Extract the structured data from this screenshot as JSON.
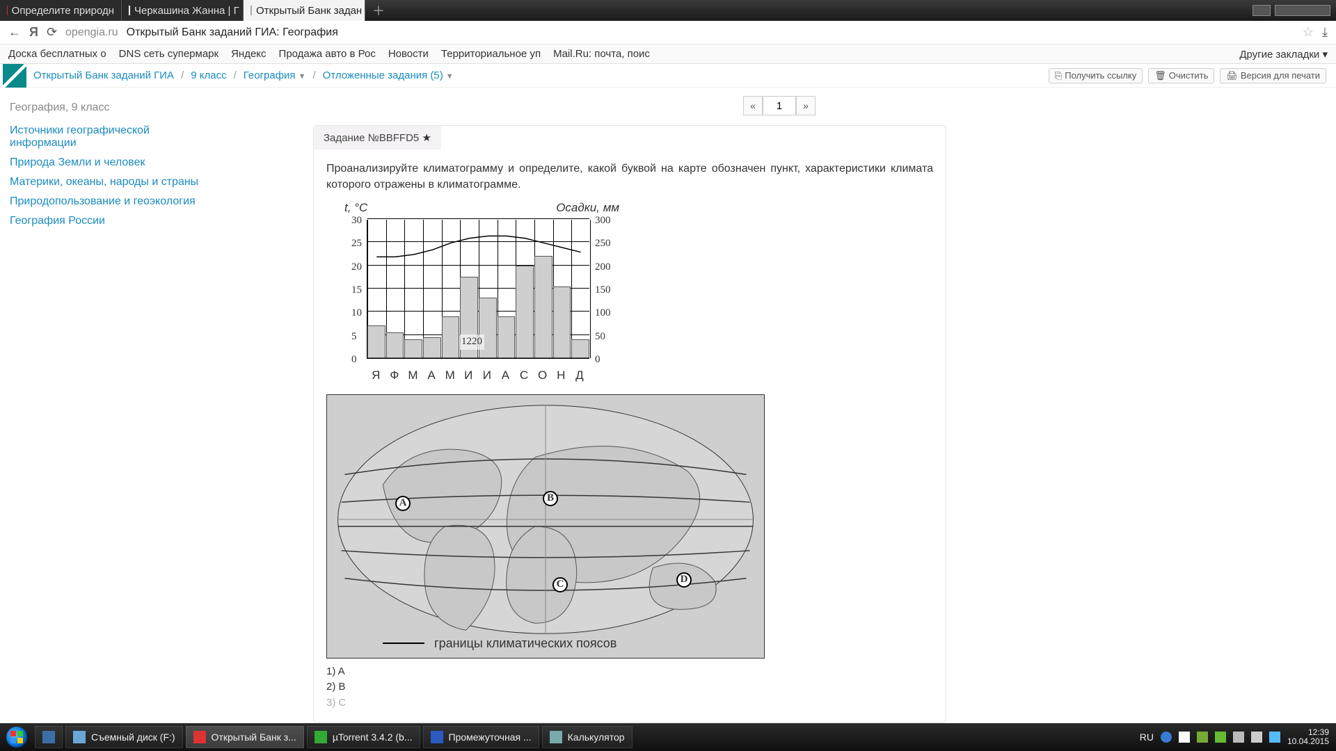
{
  "tabs": [
    {
      "label": "Определите природн",
      "favclass": "fav-red"
    },
    {
      "label": "Черкашина Жанна | Г",
      "favclass": "fav-blue"
    },
    {
      "label": "Открытый Банк задан",
      "favclass": "fav-page",
      "active": true
    }
  ],
  "addressbar": {
    "host": "opengia.ru",
    "title": "Открытый Банк заданий ГИА: География"
  },
  "bookmarks": [
    "Доска бесплатных о",
    "DNS сеть супермарк",
    "Яндекс",
    "Продажа авто в Рос",
    "Новости",
    "Территориальное уп",
    "Mail.Ru: почта, поис"
  ],
  "bookmarks_other": "Другие закладки ▾",
  "breadcrumb": {
    "root": "Открытый Банк заданий ГИА",
    "lvl1": "9 класс",
    "lvl2": "География",
    "lvl3": "Отложенные задания (5)"
  },
  "toolbar": {
    "link": "Получить ссылку",
    "clear": "Очистить",
    "print": "Версия для печати"
  },
  "sidebar": {
    "heading": "География, 9 класс",
    "links": [
      "Источники географической информации",
      "Природа Земли и человек",
      "Материки, океаны, народы и страны",
      "Природопользование и геоэкология",
      "География России"
    ]
  },
  "pager": {
    "prev": "«",
    "value": "1",
    "next": "»"
  },
  "task": {
    "id_label": "Задание №BBFFD5",
    "star": "★",
    "text": "Проанализируйте климатограмму и определите, какой буквой на карте обозначен пункт, характеристики климата которого отражены в климатограмме."
  },
  "chart_data": {
    "type": "bar+line",
    "title_left": "t, °C",
    "title_right": "Осадки, мм",
    "categories": [
      "Я",
      "Ф",
      "М",
      "А",
      "М",
      "И",
      "И",
      "А",
      "С",
      "О",
      "Н",
      "Д"
    ],
    "y_left_ticks": [
      0,
      5,
      10,
      15,
      20,
      25,
      30
    ],
    "y_right_ticks": [
      0,
      50,
      100,
      150,
      200,
      250,
      300
    ],
    "ylim_left": [
      0,
      30
    ],
    "ylim_right": [
      0,
      300
    ],
    "series": [
      {
        "name": "Осадки",
        "axis": "right",
        "kind": "bar",
        "values": [
          70,
          55,
          40,
          45,
          90,
          175,
          130,
          90,
          200,
          220,
          155,
          40
        ]
      },
      {
        "name": "Температура",
        "axis": "left",
        "kind": "line",
        "values": [
          22,
          22,
          22.5,
          23.5,
          25,
          26,
          26.5,
          26.5,
          26,
          25,
          24,
          23
        ]
      }
    ],
    "annotation": "1220"
  },
  "map": {
    "markers": [
      "A",
      "B",
      "C",
      "D"
    ],
    "legend": "границы климатических поясов"
  },
  "answers": [
    "1)  A",
    "2)  B",
    "3)  C"
  ],
  "taskbar": {
    "items": [
      {
        "label": "",
        "icon": "#3b6ea5"
      },
      {
        "label": "Съемный диск (F:)",
        "icon": "#6aa7d8"
      },
      {
        "label": "Открытый Банк з...",
        "icon": "#d33",
        "active": true
      },
      {
        "label": "µTorrent 3.4.2  (b...",
        "icon": "#3a3"
      },
      {
        "label": "Промежуточная ...",
        "icon": "#2a5bbf"
      },
      {
        "label": "Калькулятор",
        "icon": "#7aa"
      }
    ],
    "lang": "RU",
    "time": "12:39",
    "date": "10.04.2015"
  }
}
